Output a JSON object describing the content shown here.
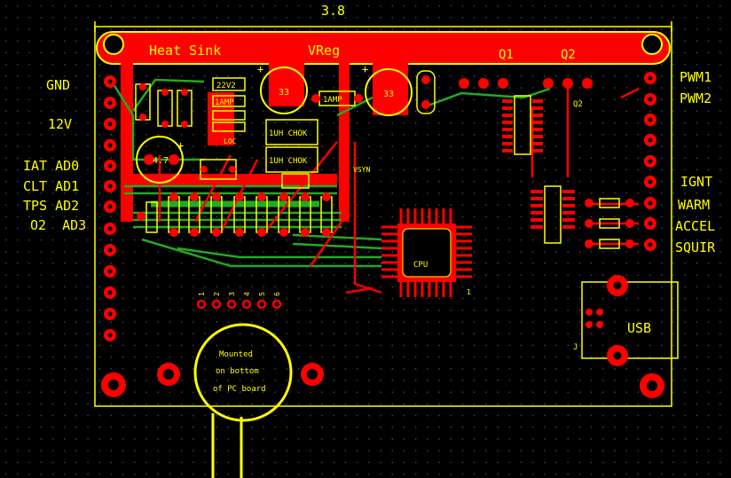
{
  "colors": {
    "background": "#000000",
    "grid_dot": "#5a5a5a",
    "copper_top": "#ff0000",
    "copper_bottom": "#22aa22",
    "silkscreen": "#ffff00",
    "pad": "#ff0000",
    "drill": "#000000"
  },
  "dimension": "3.8",
  "heat_sink": {
    "label": "Heat Sink"
  },
  "vreg": {
    "label": "VReg"
  },
  "transistors": {
    "q1": "Q1",
    "q2": "Q2",
    "q2_small": "Q2"
  },
  "left_labels": {
    "gnd": "GND",
    "v12": "12V",
    "iat": "IAT AD0",
    "clt": "CLT AD1",
    "tps": "TPS AD2",
    "o2": "O2  AD3"
  },
  "right_labels": {
    "pwm1": "PWM1",
    "pwm2": "PWM2",
    "ignt": "IGNT",
    "warm": "WARM",
    "accel": "ACCEL",
    "squir": "SQUIR"
  },
  "components": {
    "cap_left": "4.7",
    "cap_mid": "33",
    "cap_right": "33",
    "fuse_1": "1AMP",
    "fuse_2": "1AMP",
    "zener": "22V2",
    "choke_1": "1UH CHOK",
    "choke_2": "1UH CHOK",
    "vsyn": "VSYN",
    "cpu": "CPU",
    "cpu_pin1": "1",
    "usb": "USB",
    "j_label": "J",
    "loc": "LOC"
  },
  "header_pins": [
    "1",
    "2",
    "3",
    "4",
    "5",
    "6"
  ],
  "sensor": {
    "line1": "Mounted",
    "line2": "on bottom",
    "line3": "of PC board"
  }
}
